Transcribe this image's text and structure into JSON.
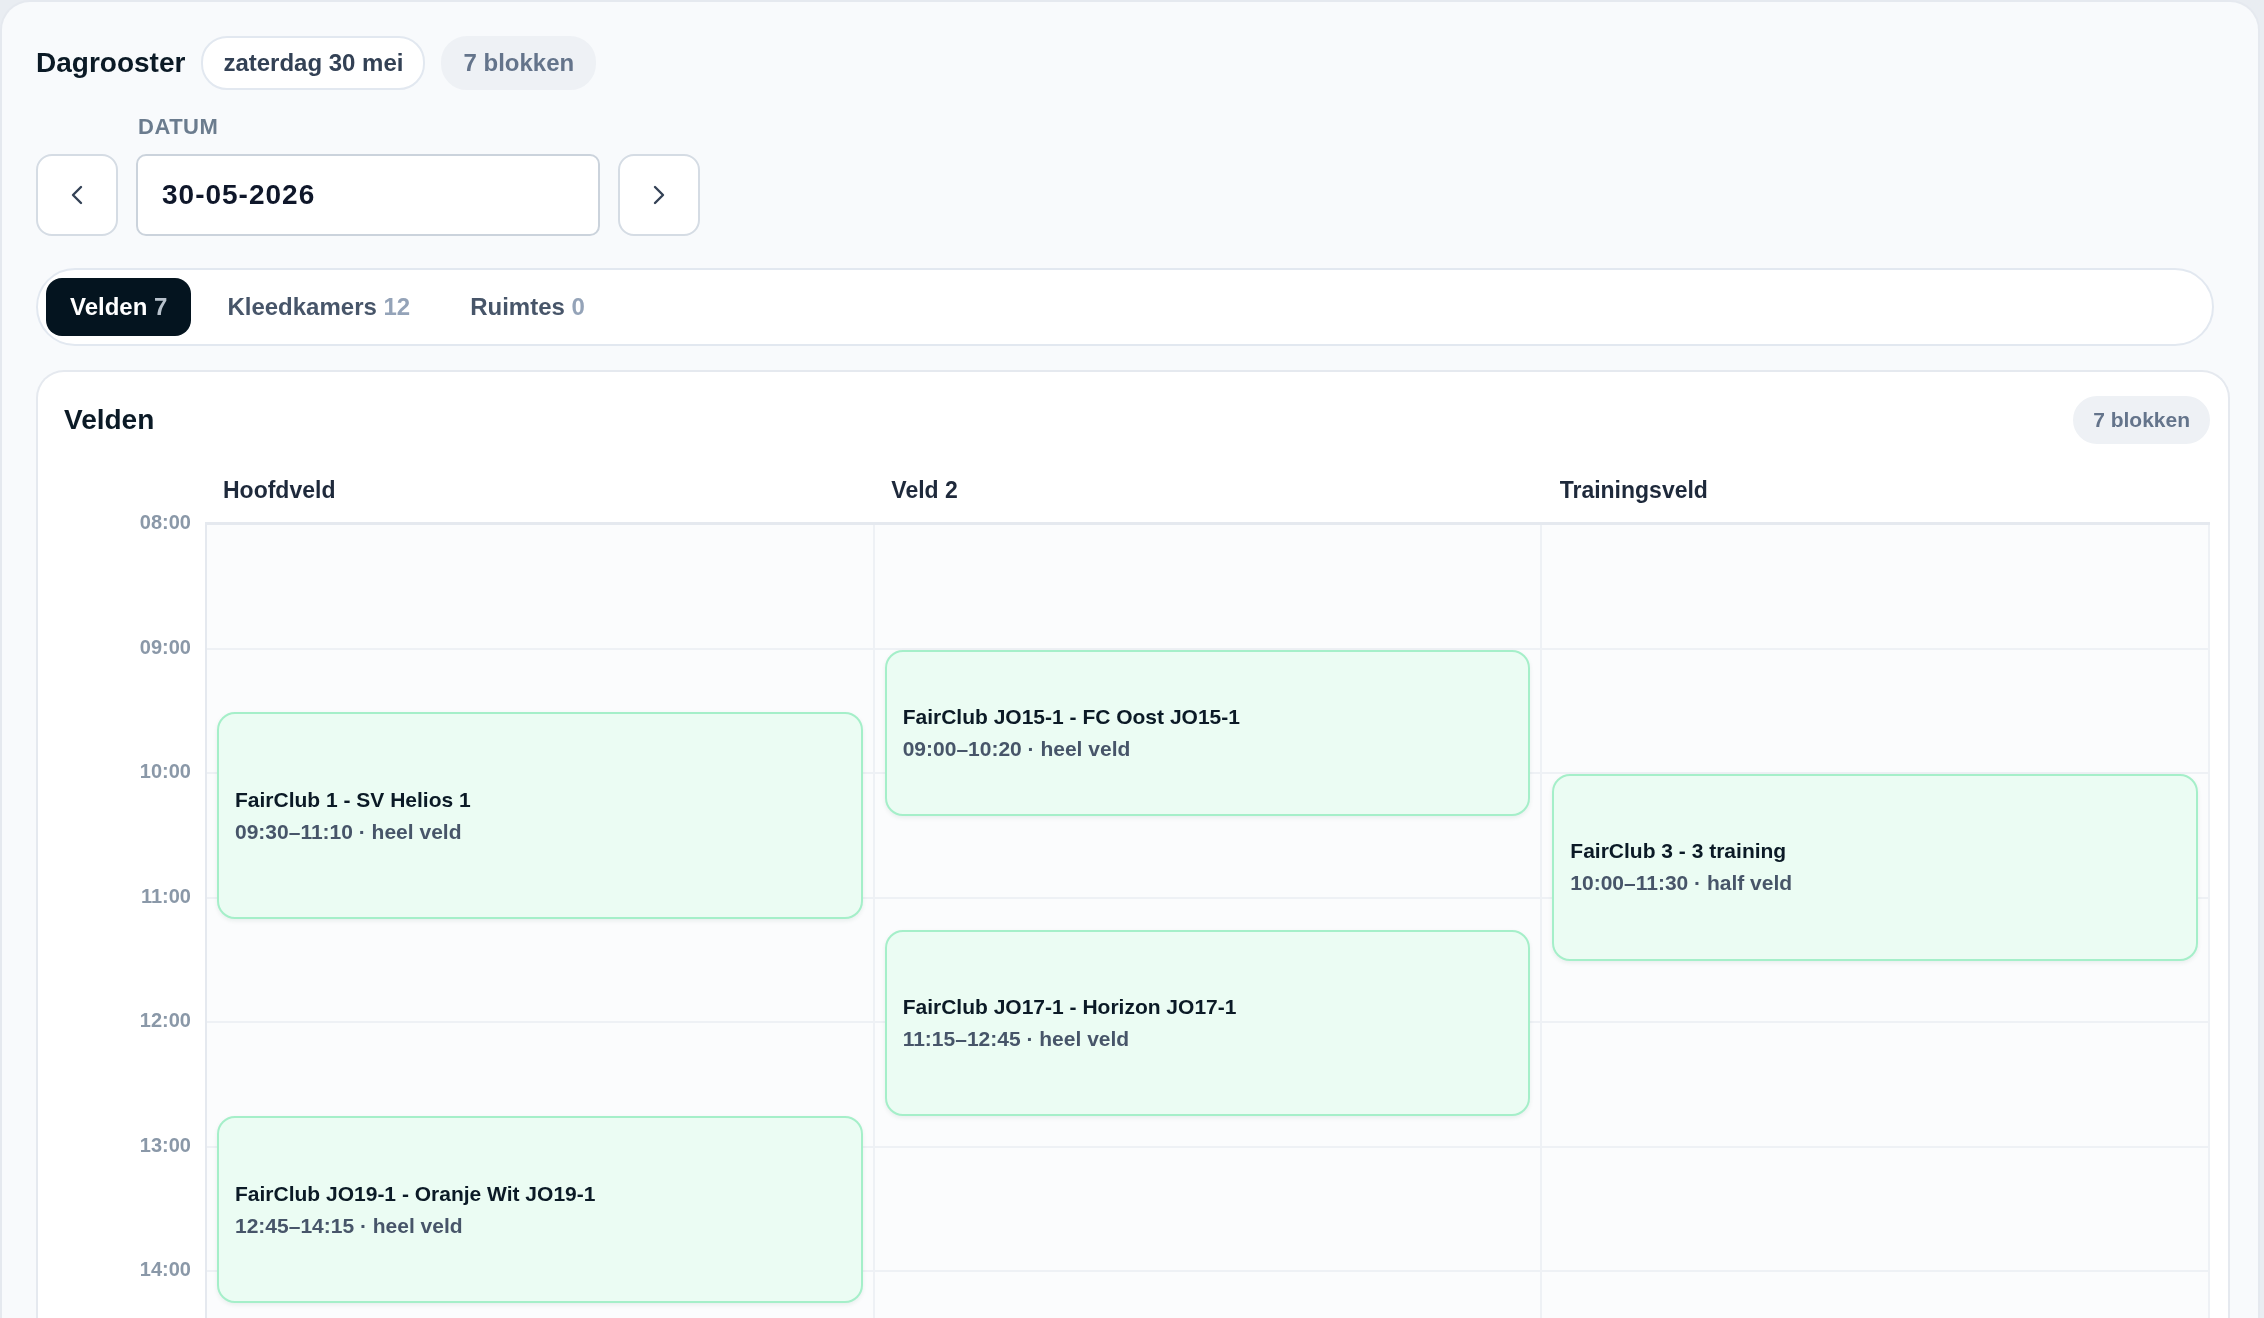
{
  "header": {
    "title": "Dagrooster",
    "date_chip": "zaterdag 30 mei",
    "count_chip": "7 blokken"
  },
  "date_picker": {
    "label": "DATUM",
    "value": "30-05-2026"
  },
  "tabs": [
    {
      "label": "Velden",
      "count": "7",
      "selected": true
    },
    {
      "label": "Kleedkamers",
      "count": "12",
      "selected": false
    },
    {
      "label": "Ruimtes",
      "count": "0",
      "selected": false
    }
  ],
  "schedule": {
    "title": "Velden",
    "count_badge": "7 blokken",
    "hours": [
      "08:00",
      "09:00",
      "10:00",
      "11:00",
      "12:00",
      "13:00",
      "14:00"
    ],
    "columns": [
      {
        "name": "Hoofdveld",
        "blocks": [
          {
            "title": "FairClub 1 - SV Helios 1",
            "details": "09:30–11:10 · heel veld"
          },
          {
            "title": "FairClub JO19-1 - Oranje Wit JO19-1",
            "details": "12:45–14:15 · heel veld"
          }
        ]
      },
      {
        "name": "Veld 2",
        "blocks": [
          {
            "title": "FairClub JO15-1 - FC Oost JO15-1",
            "details": "09:00–10:20 · heel veld"
          },
          {
            "title": "FairClub JO17-1 - Horizon JO17-1",
            "details": "11:15–12:45 · heel veld"
          }
        ]
      },
      {
        "name": "Trainingsveld",
        "blocks": [
          {
            "title": "FairClub 3 - 3 training",
            "details": "10:00–11:30 · half veld"
          }
        ]
      }
    ]
  }
}
